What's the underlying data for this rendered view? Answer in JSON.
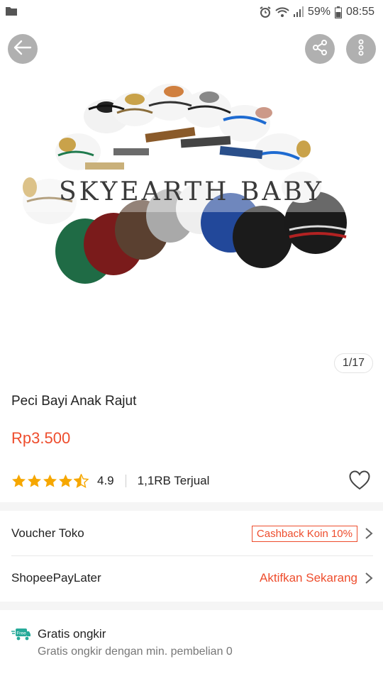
{
  "status_bar": {
    "battery": "59%",
    "time": "08:55"
  },
  "product": {
    "image_caption": "SKYEARTH BABY",
    "image_index": "1/17",
    "title": "Peci Bayi Anak Rajut",
    "price": "Rp3.500",
    "rating": "4.9",
    "rating_fraction": 0.98,
    "sold": "1,1RB Terjual"
  },
  "rows": {
    "voucher_label": "Voucher Toko",
    "voucher_tag": "Cashback Koin 10%",
    "paylater_label": "ShopeePayLater",
    "paylater_action": "Aktifkan Sekarang"
  },
  "shipping": {
    "badge": "Free",
    "title": "Gratis ongkir",
    "subtitle": "Gratis ongkir dengan min. pembelian 0"
  },
  "colors": {
    "accent": "#ee4d2d",
    "star": "#f6a700",
    "shipping_icon": "#26aa99"
  },
  "icons": {
    "back": "arrow-left-icon",
    "share": "share-icon",
    "more": "more-vertical-icon",
    "favorite": "heart-icon",
    "shipping": "truck-icon"
  }
}
